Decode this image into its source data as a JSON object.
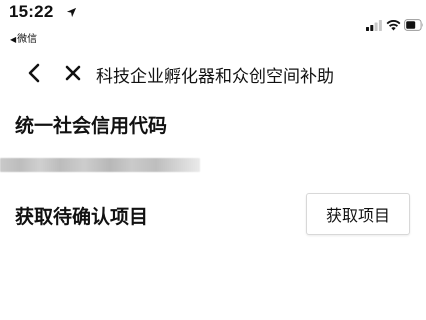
{
  "status_bar": {
    "time": "15:22",
    "back_app": "微信",
    "icons": [
      "location-arrow-icon",
      "signal-icon",
      "wifi-icon",
      "battery-icon"
    ]
  },
  "nav": {
    "title": "科技企业孵化器和众创空间补助",
    "back_icon": "chevron-left-icon",
    "close_icon": "close-icon"
  },
  "form": {
    "credit_code_label": "统一社会信用代码",
    "credit_code_value_redacted": true,
    "confirm_items_label": "获取待确认项目",
    "fetch_button_label": "获取项目"
  },
  "colors": {
    "text": "#111111",
    "background": "#ffffff",
    "button_border": "#d8d8d8",
    "redaction": "#c4c4c4"
  }
}
